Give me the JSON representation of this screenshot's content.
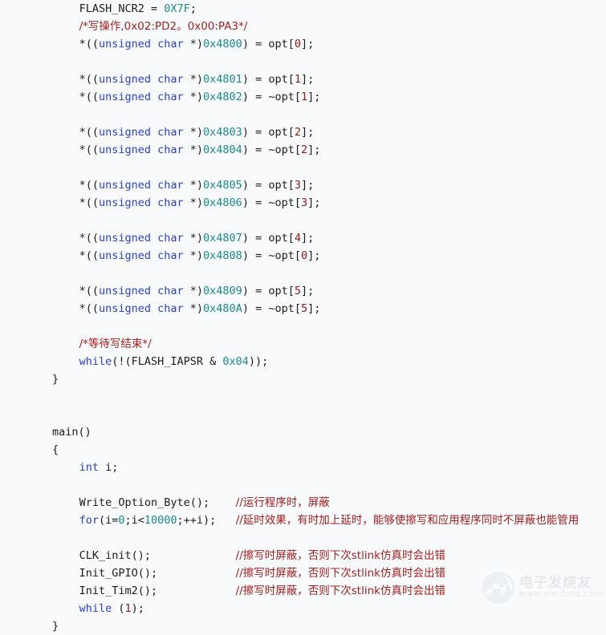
{
  "editor": {
    "background_color": "#f8fafb",
    "language": "c",
    "font_size_px": 13.5,
    "line_height_px": 22,
    "colors": {
      "plain": "#1c1c1c",
      "keyword": "#2b40c8",
      "number": "#1a8a8a",
      "index": "#8b1a1a",
      "comment": "#a32020"
    }
  },
  "code": {
    "lines": [
      {
        "id": "line-1",
        "indent": 2,
        "segments": [
          {
            "t": "FLASH_NCR2 = ",
            "c": "plain"
          },
          {
            "t": "0X7F",
            "c": "number"
          },
          {
            "t": ";",
            "c": "plain"
          }
        ]
      },
      {
        "id": "line-2",
        "indent": 2,
        "segments": [
          {
            "t": "/*写操作,0x02:PD2。0x00:PA3*/",
            "c": "comment"
          }
        ]
      },
      {
        "id": "line-3",
        "indent": 2,
        "segments": [
          {
            "t": "*((",
            "c": "plain"
          },
          {
            "t": "unsigned char",
            "c": "keyword"
          },
          {
            "t": " *)",
            "c": "plain"
          },
          {
            "t": "0x4800",
            "c": "number"
          },
          {
            "t": ") = opt[",
            "c": "plain"
          },
          {
            "t": "0",
            "c": "index"
          },
          {
            "t": "];",
            "c": "plain"
          }
        ]
      },
      {
        "id": "line-4",
        "indent": 0,
        "segments": []
      },
      {
        "id": "line-5",
        "indent": 2,
        "segments": [
          {
            "t": "*((",
            "c": "plain"
          },
          {
            "t": "unsigned char",
            "c": "keyword"
          },
          {
            "t": " *)",
            "c": "plain"
          },
          {
            "t": "0x4801",
            "c": "number"
          },
          {
            "t": ") = opt[",
            "c": "plain"
          },
          {
            "t": "1",
            "c": "index"
          },
          {
            "t": "];",
            "c": "plain"
          }
        ]
      },
      {
        "id": "line-6",
        "indent": 2,
        "segments": [
          {
            "t": "*((",
            "c": "plain"
          },
          {
            "t": "unsigned char",
            "c": "keyword"
          },
          {
            "t": " *)",
            "c": "plain"
          },
          {
            "t": "0x4802",
            "c": "number"
          },
          {
            "t": ") = ~opt[",
            "c": "plain"
          },
          {
            "t": "1",
            "c": "index"
          },
          {
            "t": "];",
            "c": "plain"
          }
        ]
      },
      {
        "id": "line-7",
        "indent": 0,
        "segments": []
      },
      {
        "id": "line-8",
        "indent": 2,
        "segments": [
          {
            "t": "*((",
            "c": "plain"
          },
          {
            "t": "unsigned char",
            "c": "keyword"
          },
          {
            "t": " *)",
            "c": "plain"
          },
          {
            "t": "0x4803",
            "c": "number"
          },
          {
            "t": ") = opt[",
            "c": "plain"
          },
          {
            "t": "2",
            "c": "index"
          },
          {
            "t": "];",
            "c": "plain"
          }
        ]
      },
      {
        "id": "line-9",
        "indent": 2,
        "segments": [
          {
            "t": "*((",
            "c": "plain"
          },
          {
            "t": "unsigned char",
            "c": "keyword"
          },
          {
            "t": " *)",
            "c": "plain"
          },
          {
            "t": "0x4804",
            "c": "number"
          },
          {
            "t": ") = ~opt[",
            "c": "plain"
          },
          {
            "t": "2",
            "c": "index"
          },
          {
            "t": "];",
            "c": "plain"
          }
        ]
      },
      {
        "id": "line-10",
        "indent": 0,
        "segments": []
      },
      {
        "id": "line-11",
        "indent": 2,
        "segments": [
          {
            "t": "*((",
            "c": "plain"
          },
          {
            "t": "unsigned char",
            "c": "keyword"
          },
          {
            "t": " *)",
            "c": "plain"
          },
          {
            "t": "0x4805",
            "c": "number"
          },
          {
            "t": ") = opt[",
            "c": "plain"
          },
          {
            "t": "3",
            "c": "index"
          },
          {
            "t": "];",
            "c": "plain"
          }
        ]
      },
      {
        "id": "line-12",
        "indent": 2,
        "segments": [
          {
            "t": "*((",
            "c": "plain"
          },
          {
            "t": "unsigned char",
            "c": "keyword"
          },
          {
            "t": " *)",
            "c": "plain"
          },
          {
            "t": "0x4806",
            "c": "number"
          },
          {
            "t": ") = ~opt[",
            "c": "plain"
          },
          {
            "t": "3",
            "c": "index"
          },
          {
            "t": "];",
            "c": "plain"
          }
        ]
      },
      {
        "id": "line-13",
        "indent": 0,
        "segments": []
      },
      {
        "id": "line-14",
        "indent": 2,
        "segments": [
          {
            "t": "*((",
            "c": "plain"
          },
          {
            "t": "unsigned char",
            "c": "keyword"
          },
          {
            "t": " *)",
            "c": "plain"
          },
          {
            "t": "0x4807",
            "c": "number"
          },
          {
            "t": ") = opt[",
            "c": "plain"
          },
          {
            "t": "4",
            "c": "index"
          },
          {
            "t": "];",
            "c": "plain"
          }
        ]
      },
      {
        "id": "line-15",
        "indent": 2,
        "segments": [
          {
            "t": "*((",
            "c": "plain"
          },
          {
            "t": "unsigned char",
            "c": "keyword"
          },
          {
            "t": " *)",
            "c": "plain"
          },
          {
            "t": "0x4808",
            "c": "number"
          },
          {
            "t": ") = ~opt[",
            "c": "plain"
          },
          {
            "t": "0",
            "c": "index"
          },
          {
            "t": "];",
            "c": "plain"
          }
        ]
      },
      {
        "id": "line-16",
        "indent": 0,
        "segments": []
      },
      {
        "id": "line-17",
        "indent": 2,
        "segments": [
          {
            "t": "*((",
            "c": "plain"
          },
          {
            "t": "unsigned char",
            "c": "keyword"
          },
          {
            "t": " *)",
            "c": "plain"
          },
          {
            "t": "0x4809",
            "c": "number"
          },
          {
            "t": ") = opt[",
            "c": "plain"
          },
          {
            "t": "5",
            "c": "index"
          },
          {
            "t": "];",
            "c": "plain"
          }
        ]
      },
      {
        "id": "line-18",
        "indent": 2,
        "segments": [
          {
            "t": "*((",
            "c": "plain"
          },
          {
            "t": "unsigned char",
            "c": "keyword"
          },
          {
            "t": " *)",
            "c": "plain"
          },
          {
            "t": "0x480A",
            "c": "number"
          },
          {
            "t": ") = ~opt[",
            "c": "plain"
          },
          {
            "t": "5",
            "c": "index"
          },
          {
            "t": "];",
            "c": "plain"
          }
        ]
      },
      {
        "id": "line-19",
        "indent": 0,
        "segments": []
      },
      {
        "id": "line-20",
        "indent": 2,
        "segments": [
          {
            "t": "/*等待写结束*/",
            "c": "comment"
          }
        ]
      },
      {
        "id": "line-21",
        "indent": 2,
        "segments": [
          {
            "t": "while",
            "c": "keyword"
          },
          {
            "t": "(!(FLASH_IAPSR & ",
            "c": "plain"
          },
          {
            "t": "0x04",
            "c": "number"
          },
          {
            "t": "));",
            "c": "plain"
          }
        ]
      },
      {
        "id": "line-22",
        "indent": 0,
        "segments": [
          {
            "t": "}",
            "c": "plain"
          }
        ]
      },
      {
        "id": "line-23",
        "indent": 0,
        "segments": []
      },
      {
        "id": "line-24",
        "indent": 0,
        "segments": []
      },
      {
        "id": "line-25",
        "indent": 0,
        "segments": [
          {
            "t": "main()",
            "c": "plain"
          }
        ]
      },
      {
        "id": "line-26",
        "indent": 0,
        "segments": [
          {
            "t": "{",
            "c": "plain"
          }
        ]
      },
      {
        "id": "line-27",
        "indent": 2,
        "segments": [
          {
            "t": "int",
            "c": "keyword"
          },
          {
            "t": " i;",
            "c": "plain"
          }
        ]
      },
      {
        "id": "line-28",
        "indent": 0,
        "segments": []
      },
      {
        "id": "line-29",
        "indent": 2,
        "segments": [
          {
            "t": "Write_Option_Byte();    ",
            "c": "plain"
          },
          {
            "t": "//运行程序时，屏蔽",
            "c": "comment"
          }
        ]
      },
      {
        "id": "line-30",
        "indent": 2,
        "segments": [
          {
            "t": "for",
            "c": "keyword"
          },
          {
            "t": "(i=",
            "c": "plain"
          },
          {
            "t": "0",
            "c": "number"
          },
          {
            "t": ";i<",
            "c": "plain"
          },
          {
            "t": "10000",
            "c": "number"
          },
          {
            "t": ";++i);   ",
            "c": "plain"
          },
          {
            "t": "//延时效果，有时加上延时，能够使擦写和应用程序同时不屏蔽也能管用",
            "c": "comment"
          }
        ]
      },
      {
        "id": "line-31",
        "indent": 0,
        "segments": []
      },
      {
        "id": "line-32",
        "indent": 2,
        "segments": [
          {
            "t": "CLK_init();             ",
            "c": "plain"
          },
          {
            "t": "//擦写时屏蔽，否则下次stlink仿真时会出错",
            "c": "comment"
          }
        ]
      },
      {
        "id": "line-33",
        "indent": 2,
        "segments": [
          {
            "t": "Init_GPIO();            ",
            "c": "plain"
          },
          {
            "t": "//擦写时屏蔽，否则下次stlink仿真时会出错",
            "c": "comment"
          }
        ]
      },
      {
        "id": "line-34",
        "indent": 2,
        "segments": [
          {
            "t": "Init_Tim2();            ",
            "c": "plain"
          },
          {
            "t": "//擦写时屏蔽，否则下次stlink仿真时会出错",
            "c": "comment"
          }
        ]
      },
      {
        "id": "line-35",
        "indent": 2,
        "segments": [
          {
            "t": "while",
            "c": "keyword"
          },
          {
            "t": " (",
            "c": "plain"
          },
          {
            "t": "1",
            "c": "index"
          },
          {
            "t": ");",
            "c": "plain"
          }
        ]
      },
      {
        "id": "line-36",
        "indent": 0,
        "segments": [
          {
            "t": "}",
            "c": "plain"
          }
        ]
      }
    ]
  },
  "watermark": {
    "brand_cn": "电子发烧友",
    "url": "www.elecfans.com",
    "color": "#c9ccd1"
  }
}
